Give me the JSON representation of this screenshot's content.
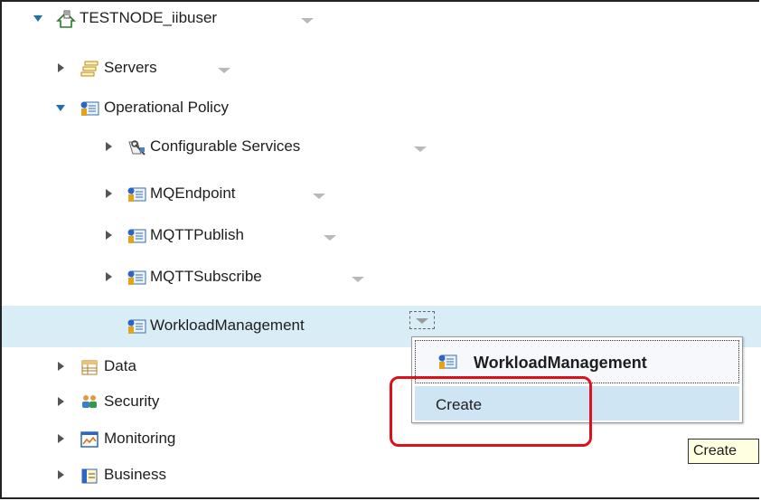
{
  "tree": {
    "root": {
      "label": "TESTNODE_iibuser",
      "icon": "integration-node-icon",
      "expanded": true
    },
    "items": [
      {
        "label": "Servers",
        "icon": "servers-icon",
        "expanded": false
      },
      {
        "label": "Operational Policy",
        "icon": "policy-icon",
        "expanded": true,
        "children": [
          {
            "label": "Configurable Services",
            "icon": "configurable-services-icon",
            "expanded": false
          },
          {
            "label": "MQEndpoint",
            "icon": "policy-icon",
            "expanded": false
          },
          {
            "label": "MQTTPublish",
            "icon": "policy-icon",
            "expanded": false
          },
          {
            "label": "MQTTSubscribe",
            "icon": "policy-icon",
            "expanded": false
          },
          {
            "label": "WorkloadManagement",
            "icon": "policy-icon",
            "selected": true
          }
        ]
      },
      {
        "label": "Data",
        "icon": "data-table-icon",
        "expanded": false
      },
      {
        "label": "Security",
        "icon": "security-users-icon",
        "expanded": false
      },
      {
        "label": "Monitoring",
        "icon": "monitoring-chart-icon",
        "expanded": false
      },
      {
        "label": "Business",
        "icon": "business-icon",
        "expanded": false
      }
    ]
  },
  "context_menu": {
    "header_label": "WorkloadManagement",
    "header_icon": "policy-icon",
    "items": [
      {
        "label": "Create"
      }
    ]
  },
  "tooltip": {
    "text": "Create"
  },
  "colors": {
    "selection_bg": "#d9edf7",
    "menu_item_hover": "#cfe5f3",
    "twisty": "#1f5f99",
    "annotation_red": "#e0101a"
  }
}
